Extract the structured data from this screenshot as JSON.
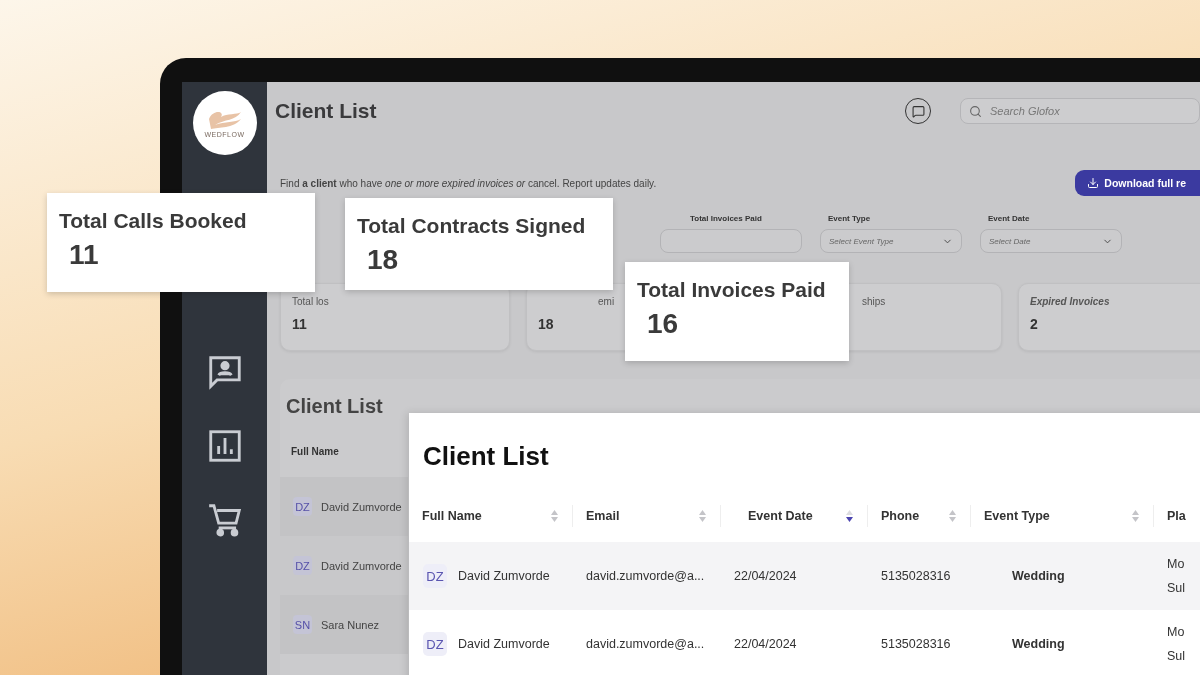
{
  "sidebar": {
    "logo_text": "WEDFLOW",
    "items": [
      {
        "kind": "contact"
      },
      {
        "kind": "chart"
      },
      {
        "kind": "cart"
      }
    ]
  },
  "header": {
    "title": "Client List",
    "search": {
      "placeholder": "Search Glofox"
    }
  },
  "intro": {
    "text": "Find **a client** who have *one or more expired invoices or* cancel. Report updates daily.",
    "download_button": "Download full re"
  },
  "filters": [
    {
      "label": "Total Invoices Paid",
      "kind": "input"
    },
    {
      "label": "Event Type",
      "kind": "select",
      "placeholder": "Select Event Type"
    },
    {
      "label": "Event Date",
      "kind": "select",
      "placeholder": "Select Date"
    }
  ],
  "stat_cards": [
    {
      "label": "Total los",
      "value": "11"
    },
    {
      "label": "emi",
      "value": "18"
    },
    {
      "label": "ships"
    },
    {
      "label": "Expired Invoices",
      "value": "2"
    }
  ],
  "client_panel": {
    "title": "Client List",
    "columns": [
      "Full Name"
    ],
    "rows": [
      {
        "initials": "DZ",
        "name": "David Zumvorde"
      },
      {
        "initials": "DZ",
        "name": "David Zumvorde"
      },
      {
        "initials": "SN",
        "name": "Sara Nunez"
      }
    ]
  },
  "highlights": [
    {
      "label": "Total Calls Booked",
      "value": "11"
    },
    {
      "label": "Total Contracts Signed",
      "value": "18"
    },
    {
      "label": "Total Invoices Paid",
      "value": "16"
    }
  ],
  "client_table": {
    "title": "Client List",
    "columns": [
      {
        "label": "Full Name",
        "sorted_desc": false
      },
      {
        "label": "Email",
        "sorted_desc": false
      },
      {
        "label": "Event Date",
        "sorted_desc": true
      },
      {
        "label": "Phone",
        "sorted_desc": false
      },
      {
        "label": "Event Type",
        "sorted_desc": false
      },
      {
        "label": "Pla"
      }
    ],
    "rows": [
      {
        "initials": "DZ",
        "name": "David Zumvorde",
        "email": "david.zumvorde@a...",
        "event_date": "22/04/2024",
        "phone": "5135028316",
        "event_type": "Wedding",
        "place": [
          "Mo",
          "Sul"
        ]
      },
      {
        "initials": "DZ",
        "name": "David Zumvorde",
        "email": "david.zumvorde@a...",
        "event_date": "22/04/2024",
        "phone": "5135028316",
        "event_type": "Wedding",
        "place": [
          "Mo",
          "Sul"
        ]
      }
    ]
  }
}
